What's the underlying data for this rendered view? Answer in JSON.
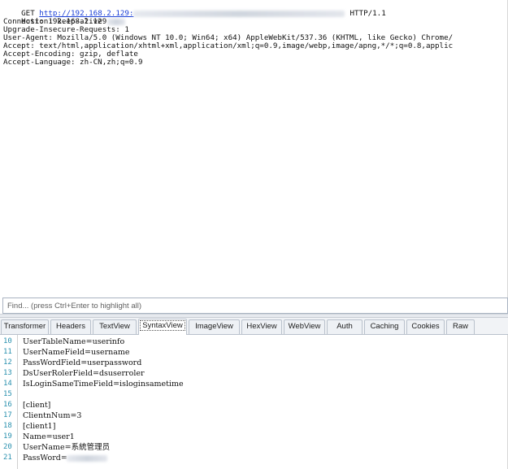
{
  "request": {
    "method": "GET",
    "url": "http://192.168.2.129:",
    "protocol": "HTTP/1.1",
    "host_line": "Host: 192.168.2.129",
    "headers": [
      "Connection: keep-alive",
      "Upgrade-Insecure-Requests: 1",
      "User-Agent: Mozilla/5.0 (Windows NT 10.0; Win64; x64) AppleWebKit/537.36 (KHTML, like Gecko) Chrome/",
      "Accept: text/html,application/xhtml+xml,application/xml;q=0.9,image/webp,image/apng,*/*;q=0.8,applic",
      "Accept-Encoding: gzip, deflate",
      "Accept-Language: zh-CN,zh;q=0.9"
    ]
  },
  "find": {
    "placeholder": "Find... (press Ctrl+Enter to highlight all)"
  },
  "tabs": [
    {
      "label": "Transformer",
      "active": false
    },
    {
      "label": "Headers",
      "active": false
    },
    {
      "label": "TextView",
      "active": false
    },
    {
      "label": "SyntaxView",
      "active": true
    },
    {
      "label": "ImageView",
      "active": false
    },
    {
      "label": "HexView",
      "active": false
    },
    {
      "label": "WebView",
      "active": false
    },
    {
      "label": "Auth",
      "active": false
    },
    {
      "label": "Caching",
      "active": false
    },
    {
      "label": "Cookies",
      "active": false
    },
    {
      "label": "Raw",
      "active": false
    }
  ],
  "syntax": {
    "lines": [
      {
        "num": "10",
        "text": "UserTableName=userinfo"
      },
      {
        "num": "11",
        "text": "UserNameField=username"
      },
      {
        "num": "12",
        "text": "PassWordField=userpassword"
      },
      {
        "num": "13",
        "text": "DsUserRolerField=dsuserroler"
      },
      {
        "num": "14",
        "text": "IsLoginSameTimeField=isloginsametime"
      },
      {
        "num": "15",
        "text": ""
      },
      {
        "num": "16",
        "text": "[client]"
      },
      {
        "num": "17",
        "text": "ClientnNum=3"
      },
      {
        "num": "18",
        "text": "[client1]"
      },
      {
        "num": "19",
        "text": "Name=user1"
      },
      {
        "num": "20",
        "text": "UserName=系統管理员"
      },
      {
        "num": "21",
        "text": "PassWord="
      }
    ]
  },
  "colors": {
    "url_link": "#1a3fd6",
    "line_number": "#2b91af"
  }
}
